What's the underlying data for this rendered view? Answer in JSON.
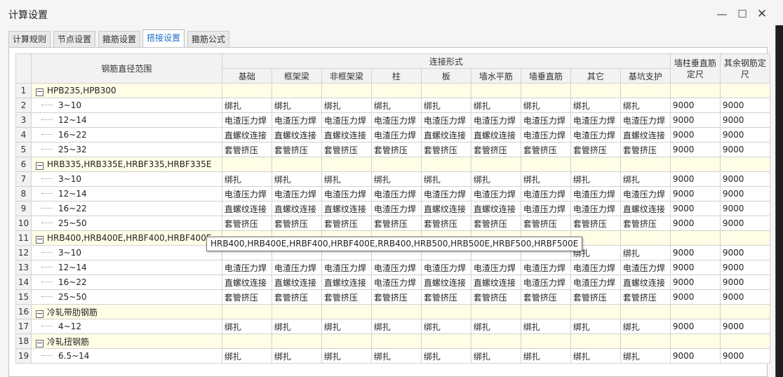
{
  "window": {
    "title": "计算设置",
    "controls": [
      "minimize-icon",
      "maximize-icon",
      "close-icon"
    ]
  },
  "tabs": [
    {
      "label": "计算规则",
      "active": false
    },
    {
      "label": "节点设置",
      "active": false
    },
    {
      "label": "箍筋设置",
      "active": false
    },
    {
      "label": "搭接设置",
      "active": true
    },
    {
      "label": "箍筋公式",
      "active": false
    }
  ],
  "table": {
    "col_range": "钢筋直径范围",
    "col_group": "连接形式",
    "sub_cols": [
      "基础",
      "框架梁",
      "非框架梁",
      "柱",
      "板",
      "墙水平筋",
      "墙垂直筋",
      "其它",
      "基坑支护"
    ],
    "col_wall": [
      "墙柱垂直筋",
      "定尺"
    ],
    "col_other": [
      "其余钢筋定",
      "尺"
    ],
    "rows": [
      {
        "num": "1",
        "group": true,
        "name": "HPB235,HPB300"
      },
      {
        "num": "2",
        "name": "3~10",
        "cells": [
          "绑扎",
          "绑扎",
          "绑扎",
          "绑扎",
          "绑扎",
          "绑扎",
          "绑扎",
          "绑扎",
          "绑扎",
          "9000",
          "9000"
        ]
      },
      {
        "num": "3",
        "name": "12~14",
        "cells": [
          "电渣压力焊",
          "电渣压力焊",
          "电渣压力焊",
          "电渣压力焊",
          "电渣压力焊",
          "电渣压力焊",
          "电渣压力焊",
          "电渣压力焊",
          "电渣压力焊",
          "9000",
          "9000"
        ]
      },
      {
        "num": "4",
        "name": "16~22",
        "cells": [
          "直螺纹连接",
          "直螺纹连接",
          "直螺纹连接",
          "电渣压力焊",
          "直螺纹连接",
          "直螺纹连接",
          "电渣压力焊",
          "电渣压力焊",
          "直螺纹连接",
          "9000",
          "9000"
        ]
      },
      {
        "num": "5",
        "name": "25~32",
        "cells": [
          "套管挤压",
          "套管挤压",
          "套管挤压",
          "套管挤压",
          "套管挤压",
          "套管挤压",
          "套管挤压",
          "套管挤压",
          "套管挤压",
          "9000",
          "9000"
        ]
      },
      {
        "num": "6",
        "group": true,
        "name": "HRB335,HRB335E,HRBF335,HRBF335E"
      },
      {
        "num": "7",
        "name": "3~10",
        "cells": [
          "绑扎",
          "绑扎",
          "绑扎",
          "绑扎",
          "绑扎",
          "绑扎",
          "绑扎",
          "绑扎",
          "绑扎",
          "9000",
          "9000"
        ]
      },
      {
        "num": "8",
        "name": "12~14",
        "cells": [
          "电渣压力焊",
          "电渣压力焊",
          "电渣压力焊",
          "电渣压力焊",
          "电渣压力焊",
          "电渣压力焊",
          "电渣压力焊",
          "电渣压力焊",
          "电渣压力焊",
          "9000",
          "9000"
        ]
      },
      {
        "num": "9",
        "name": "16~22",
        "cells": [
          "直螺纹连接",
          "直螺纹连接",
          "直螺纹连接",
          "电渣压力焊",
          "直螺纹连接",
          "直螺纹连接",
          "电渣压力焊",
          "电渣压力焊",
          "直螺纹连接",
          "9000",
          "9000"
        ]
      },
      {
        "num": "10",
        "name": "25~50",
        "cells": [
          "套管挤压",
          "套管挤压",
          "套管挤压",
          "套管挤压",
          "套管挤压",
          "套管挤压",
          "套管挤压",
          "套管挤压",
          "套管挤压",
          "9000",
          "9000"
        ]
      },
      {
        "num": "11",
        "group": true,
        "name": "HRB400,HRB400E,HRBF400,HRBF400E..."
      },
      {
        "num": "12",
        "name": "3~10",
        "cells": [
          "",
          "",
          "",
          "",
          "",
          "",
          "",
          "绑扎",
          "绑扎",
          "9000",
          "9000"
        ]
      },
      {
        "num": "13",
        "name": "12~14",
        "cells": [
          "电渣压力焊",
          "电渣压力焊",
          "电渣压力焊",
          "电渣压力焊",
          "电渣压力焊",
          "电渣压力焊",
          "电渣压力焊",
          "电渣压力焊",
          "电渣压力焊",
          "9000",
          "9000"
        ]
      },
      {
        "num": "14",
        "name": "16~22",
        "cells": [
          "直螺纹连接",
          "直螺纹连接",
          "直螺纹连接",
          "电渣压力焊",
          "直螺纹连接",
          "直螺纹连接",
          "电渣压力焊",
          "电渣压力焊",
          "直螺纹连接",
          "9000",
          "9000"
        ]
      },
      {
        "num": "15",
        "name": "25~50",
        "cells": [
          "套管挤压",
          "套管挤压",
          "套管挤压",
          "套管挤压",
          "套管挤压",
          "套管挤压",
          "套管挤压",
          "套管挤压",
          "套管挤压",
          "9000",
          "9000"
        ]
      },
      {
        "num": "16",
        "group": true,
        "name": "冷轧带肋钢筋"
      },
      {
        "num": "17",
        "name": "4~12",
        "cells": [
          "绑扎",
          "绑扎",
          "绑扎",
          "绑扎",
          "绑扎",
          "绑扎",
          "绑扎",
          "绑扎",
          "绑扎",
          "9000",
          "9000"
        ]
      },
      {
        "num": "18",
        "group": true,
        "name": "冷轧扭钢筋"
      },
      {
        "num": "19",
        "name": "6.5~14",
        "cells": [
          "绑扎",
          "绑扎",
          "绑扎",
          "绑扎",
          "绑扎",
          "绑扎",
          "绑扎",
          "绑扎",
          "绑扎",
          "9000",
          "9000"
        ]
      }
    ]
  },
  "tooltip": "HRB400,HRB400E,HRBF400,HRBF400E,RRB400,HRB500,HRB500E,HRBF500,HRBF500E",
  "toggle_symbol": "−"
}
